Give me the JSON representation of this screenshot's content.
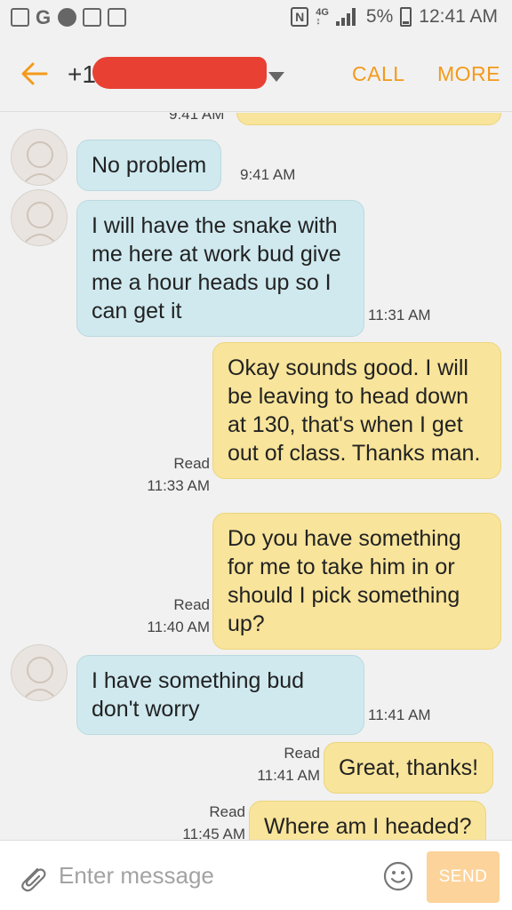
{
  "status_bar": {
    "icons": [
      "gallery-icon",
      "google-icon",
      "tumblr-icon",
      "file-icon",
      "briefcase-icon",
      "nfc-icon",
      "hd-icon",
      "signal-icon",
      "battery-icon"
    ],
    "battery": "5%",
    "time": "12:41 AM"
  },
  "header": {
    "contact": "+1",
    "call_label": "CALL",
    "more_label": "MORE",
    "accent_color": "#f39a1c"
  },
  "messages": [
    {
      "dir": "in",
      "text": "No problem",
      "time": "9:41 AM"
    },
    {
      "dir": "in",
      "text": "I will have the snake with me here at work bud give me a hour heads up so I can get it",
      "time": "11:31 AM"
    },
    {
      "dir": "out",
      "text": "Okay sounds good. I will be leaving to head down at 130, that's when I get out of class. Thanks man.",
      "status": "Read",
      "time": "11:33 AM"
    },
    {
      "dir": "out",
      "text": "Do you have something for me to take him in or should I pick something up?",
      "status": "Read",
      "time": "11:40 AM"
    },
    {
      "dir": "in",
      "text": "I have something bud don't worry",
      "time": "11:41 AM"
    },
    {
      "dir": "out",
      "text": "Great, thanks!",
      "status": "Read",
      "time": "11:41 AM"
    },
    {
      "dir": "out",
      "text": "Where am I headed?",
      "status": "Read",
      "time": "11:45 AM"
    }
  ],
  "partial_top": {
    "time": "9:41 AM"
  },
  "composer": {
    "placeholder": "Enter message",
    "send_label": "SEND"
  }
}
